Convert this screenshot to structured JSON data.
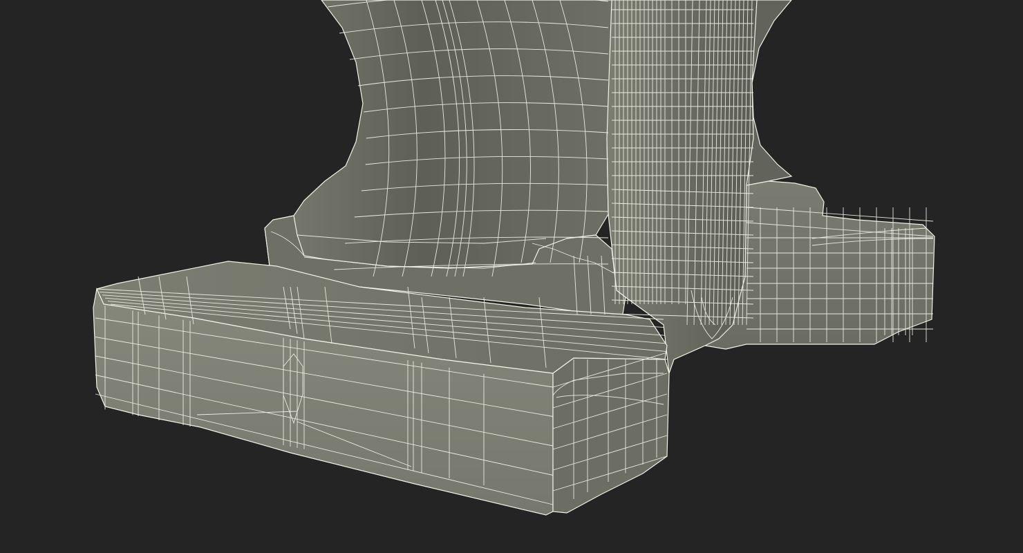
{
  "scene": {
    "subject": "anvil-base-wireframe",
    "colors": {
      "background": "#242424",
      "surface_light": "#84867a",
      "surface_mid": "#727468",
      "surface_dark": "#56584f",
      "wire": "#f2f2e6"
    }
  }
}
